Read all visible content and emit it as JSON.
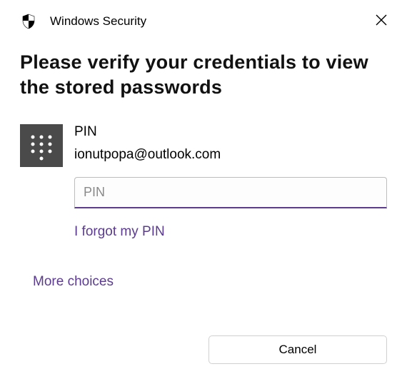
{
  "app_title": "Windows Security",
  "heading": "Please verify your credentials to view the stored passwords",
  "auth": {
    "method_label": "PIN",
    "account": "ionutpopa@outlook.com",
    "pin_placeholder": "PIN",
    "pin_value": "",
    "forgot_link": "I forgot my PIN"
  },
  "more_choices": "More choices",
  "buttons": {
    "cancel": "Cancel"
  },
  "icons": {
    "shield": "shield-icon",
    "close": "close-icon",
    "keypad": "keypad-icon"
  },
  "colors": {
    "accent": "#5b3c8e"
  }
}
